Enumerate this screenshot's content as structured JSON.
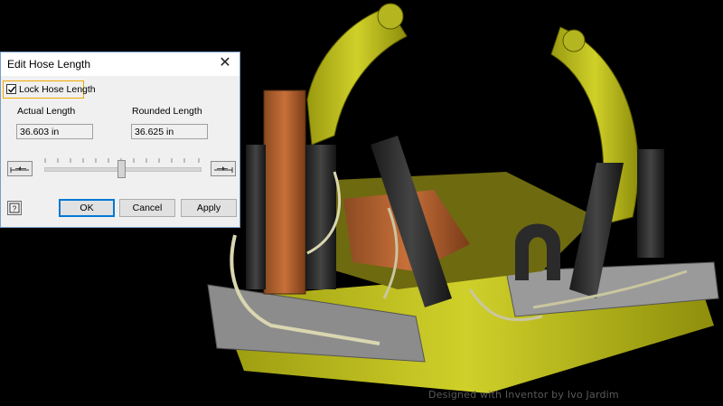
{
  "dialog": {
    "title": "Edit Hose Length",
    "lock_label": "Lock Hose Length",
    "lock_checked": true,
    "actual_label": "Actual Length",
    "actual_value": "36.603 in",
    "rounded_label": "Rounded Length",
    "rounded_value": "36.625 in",
    "ok_label": "OK",
    "cancel_label": "Cancel",
    "apply_label": "Apply"
  },
  "credit": "Designed with Inventor by Ivo Jardim",
  "icons": [
    "close-icon",
    "check-icon",
    "decrease-length-icon",
    "increase-length-icon",
    "help-icon"
  ],
  "colors": {
    "dialog_accent": "#0078d7",
    "focus_border": "#f0a800",
    "machine_yellow": "#c8c81e"
  }
}
